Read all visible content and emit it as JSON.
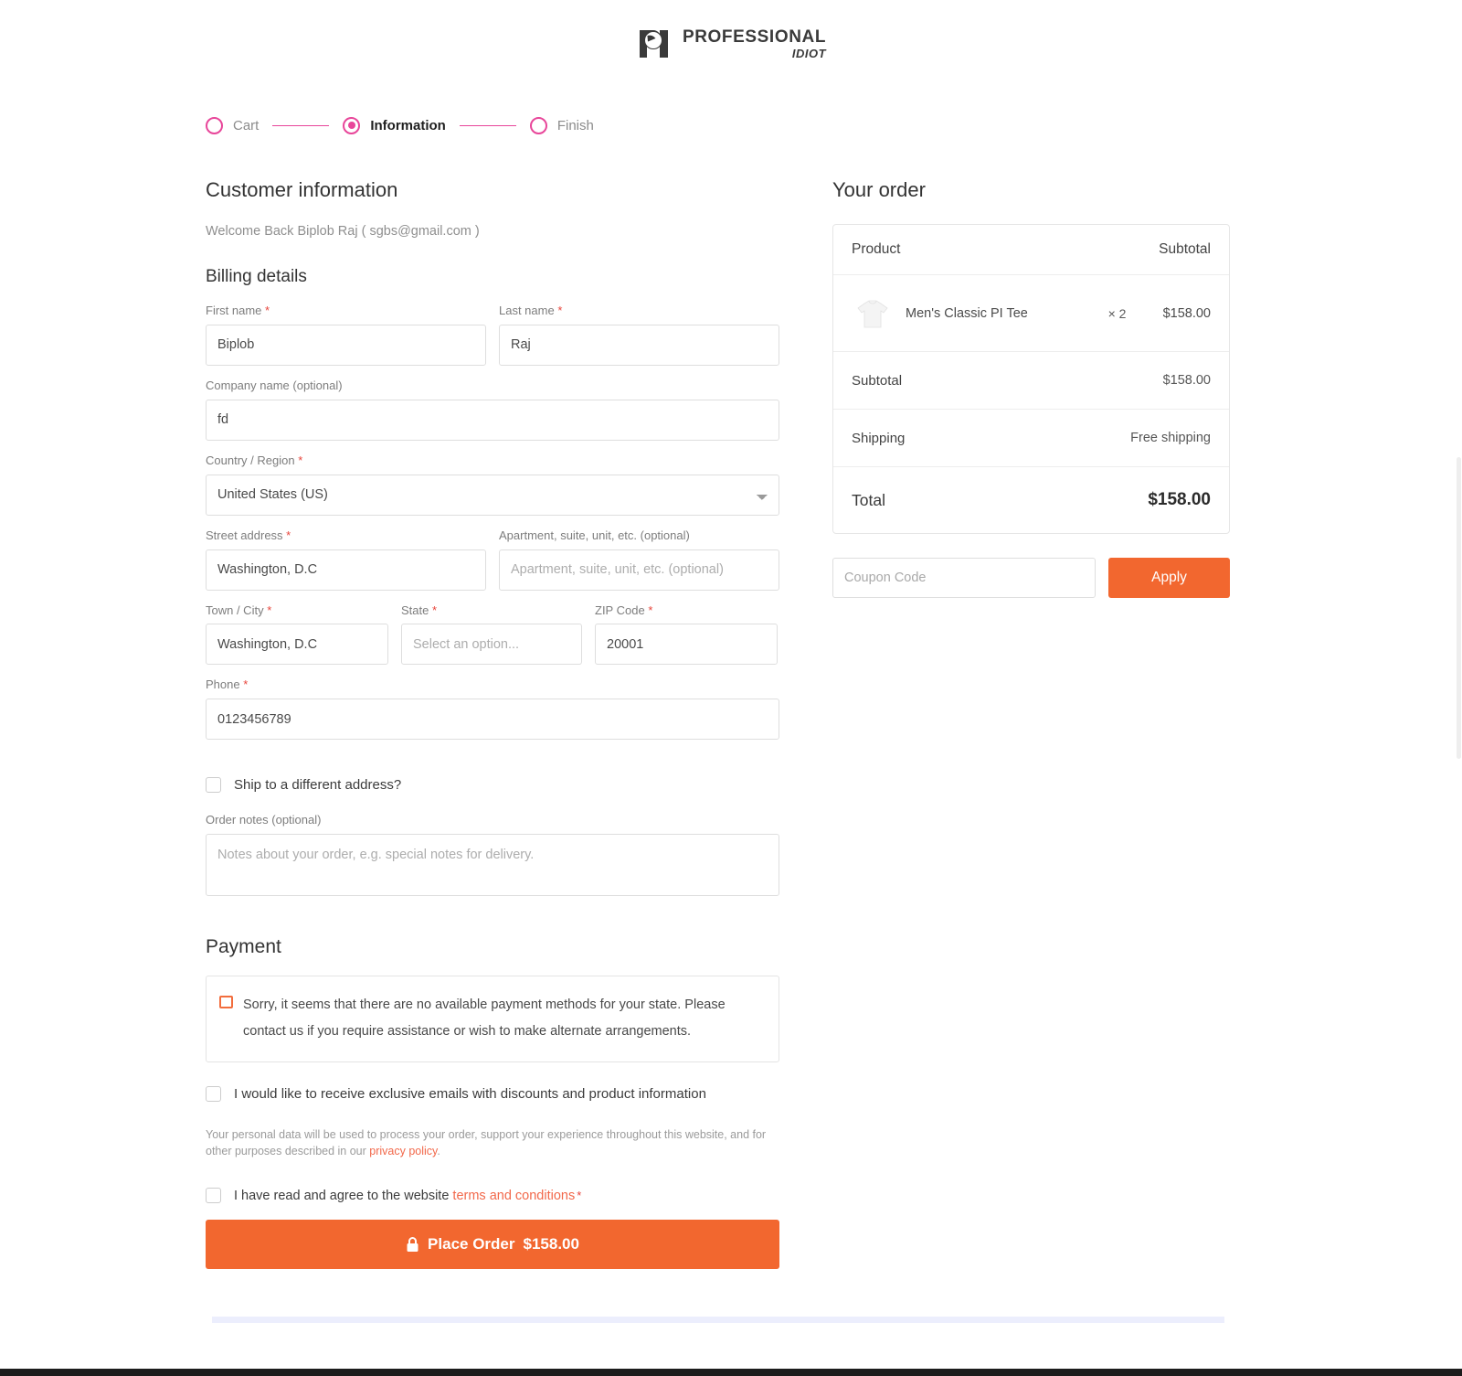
{
  "header": {
    "logo_line1": "PROFESSIONAL",
    "logo_line2": "IDIOT"
  },
  "stepper": {
    "steps": [
      {
        "label": "Cart",
        "state": "pending"
      },
      {
        "label": "Information",
        "state": "active"
      },
      {
        "label": "Finish",
        "state": "pending"
      }
    ]
  },
  "customer": {
    "title": "Customer information",
    "welcome": "Welcome Back Biplob Raj ( sgbs@gmail.com )"
  },
  "billing": {
    "title": "Billing details",
    "first_name": {
      "label": "First name",
      "required": "*",
      "value": "Biplob"
    },
    "last_name": {
      "label": "Last name",
      "required": "*",
      "value": "Raj"
    },
    "company": {
      "label": "Company name (optional)",
      "value": "fd"
    },
    "country": {
      "label": "Country / Region",
      "required": "*",
      "value": "United States (US)"
    },
    "street": {
      "label": "Street address",
      "required": "*",
      "value": "Washington, D.C"
    },
    "apartment": {
      "label": "Apartment, suite, unit, etc. (optional)",
      "placeholder": "Apartment, suite, unit, etc. (optional)",
      "value": ""
    },
    "city": {
      "label": "Town / City",
      "required": "*",
      "value": "Washington, D.C"
    },
    "state": {
      "label": "State",
      "required": "*",
      "placeholder": "Select an option...",
      "value": ""
    },
    "zip": {
      "label": "ZIP Code",
      "required": "*",
      "value": "20001"
    },
    "phone": {
      "label": "Phone",
      "required": "*",
      "value": "0123456789"
    },
    "ship_different": "Ship to a different address?",
    "order_notes": {
      "label": "Order notes (optional)",
      "placeholder": "Notes about your order, e.g. special notes for delivery.",
      "value": ""
    }
  },
  "payment": {
    "title": "Payment",
    "notice": "Sorry, it seems that there are no available payment methods for your state. Please contact us if you require assistance or wish to make alternate arrangements.",
    "emails_optin": "I would like to receive exclusive emails with discounts and product information",
    "privacy_text_before": "Your personal data will be used to process your order, support your experience throughout this website, and for other purposes described in our ",
    "privacy_link": "privacy policy",
    "privacy_text_after": ".",
    "terms_before": "I have read and agree to the website ",
    "terms_link": "terms and conditions",
    "terms_required": "*",
    "place_order_label": "Place Order",
    "place_order_amount": "$158.00"
  },
  "order": {
    "title": "Your order",
    "col_product": "Product",
    "col_subtotal": "Subtotal",
    "items": [
      {
        "name": "Men's Classic PI Tee",
        "qty": "× 2",
        "price": "$158.00"
      }
    ],
    "subtotal_label": "Subtotal",
    "subtotal_value": "$158.00",
    "shipping_label": "Shipping",
    "shipping_value": "Free shipping",
    "total_label": "Total",
    "total_value": "$158.00",
    "coupon_placeholder": "Coupon Code",
    "coupon_value": "",
    "apply_label": "Apply"
  },
  "colors": {
    "accent_orange": "#f2672f",
    "stepper_pink": "#e8469a",
    "link_orange": "#f2684a",
    "required_red": "#e8453c",
    "bottom_bar": "#eceefd"
  }
}
